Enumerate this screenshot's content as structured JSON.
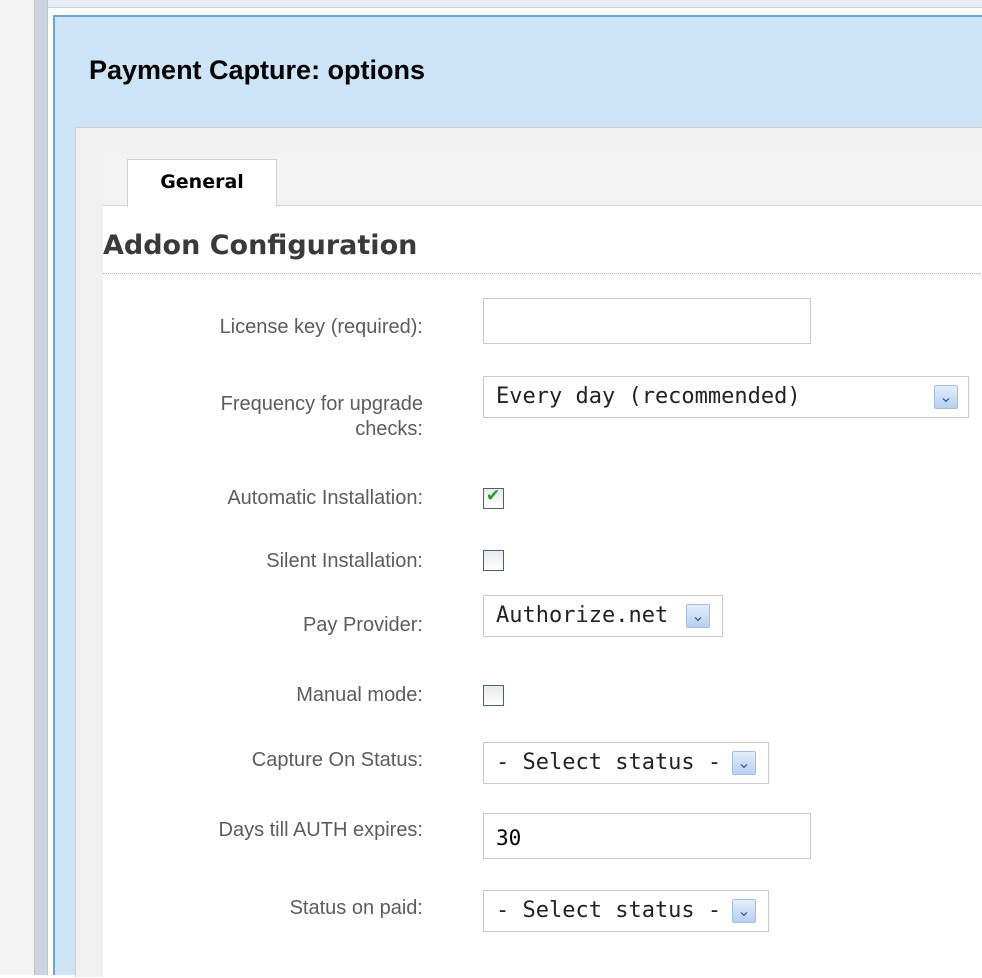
{
  "dialog": {
    "title": "Payment Capture: options"
  },
  "tabs": [
    {
      "label": "General",
      "active": true
    }
  ],
  "section": {
    "title": "Addon Configuration"
  },
  "fields": {
    "license_key": {
      "label": "License key (required):",
      "value": ""
    },
    "upgrade_frequency": {
      "label_line1": "Frequency for upgrade",
      "label_line2": "checks:",
      "selected": "Every day (recommended)"
    },
    "automatic_installation": {
      "label": "Automatic Installation:",
      "checked": true
    },
    "silent_installation": {
      "label": "Silent Installation:",
      "checked": false
    },
    "pay_provider": {
      "label": "Pay Provider:",
      "selected": "Authorize.net"
    },
    "manual_mode": {
      "label": "Manual mode:",
      "checked": false
    },
    "capture_on_status": {
      "label": "Capture On Status:",
      "selected": "- Select status -"
    },
    "days_till_auth_expires": {
      "label": "Days till AUTH expires:",
      "value": "30"
    },
    "status_on_paid": {
      "label": "Status on paid:",
      "selected": "- Select status -"
    }
  },
  "icons": {
    "dropdown": "chevron-down-icon",
    "check": "checkmark-icon"
  },
  "colors": {
    "header_bg": "#cde5f7",
    "header_border": "#6aa8dc",
    "check_green": "#1e9c1e",
    "dropdown_button": "#b7d0f2"
  }
}
